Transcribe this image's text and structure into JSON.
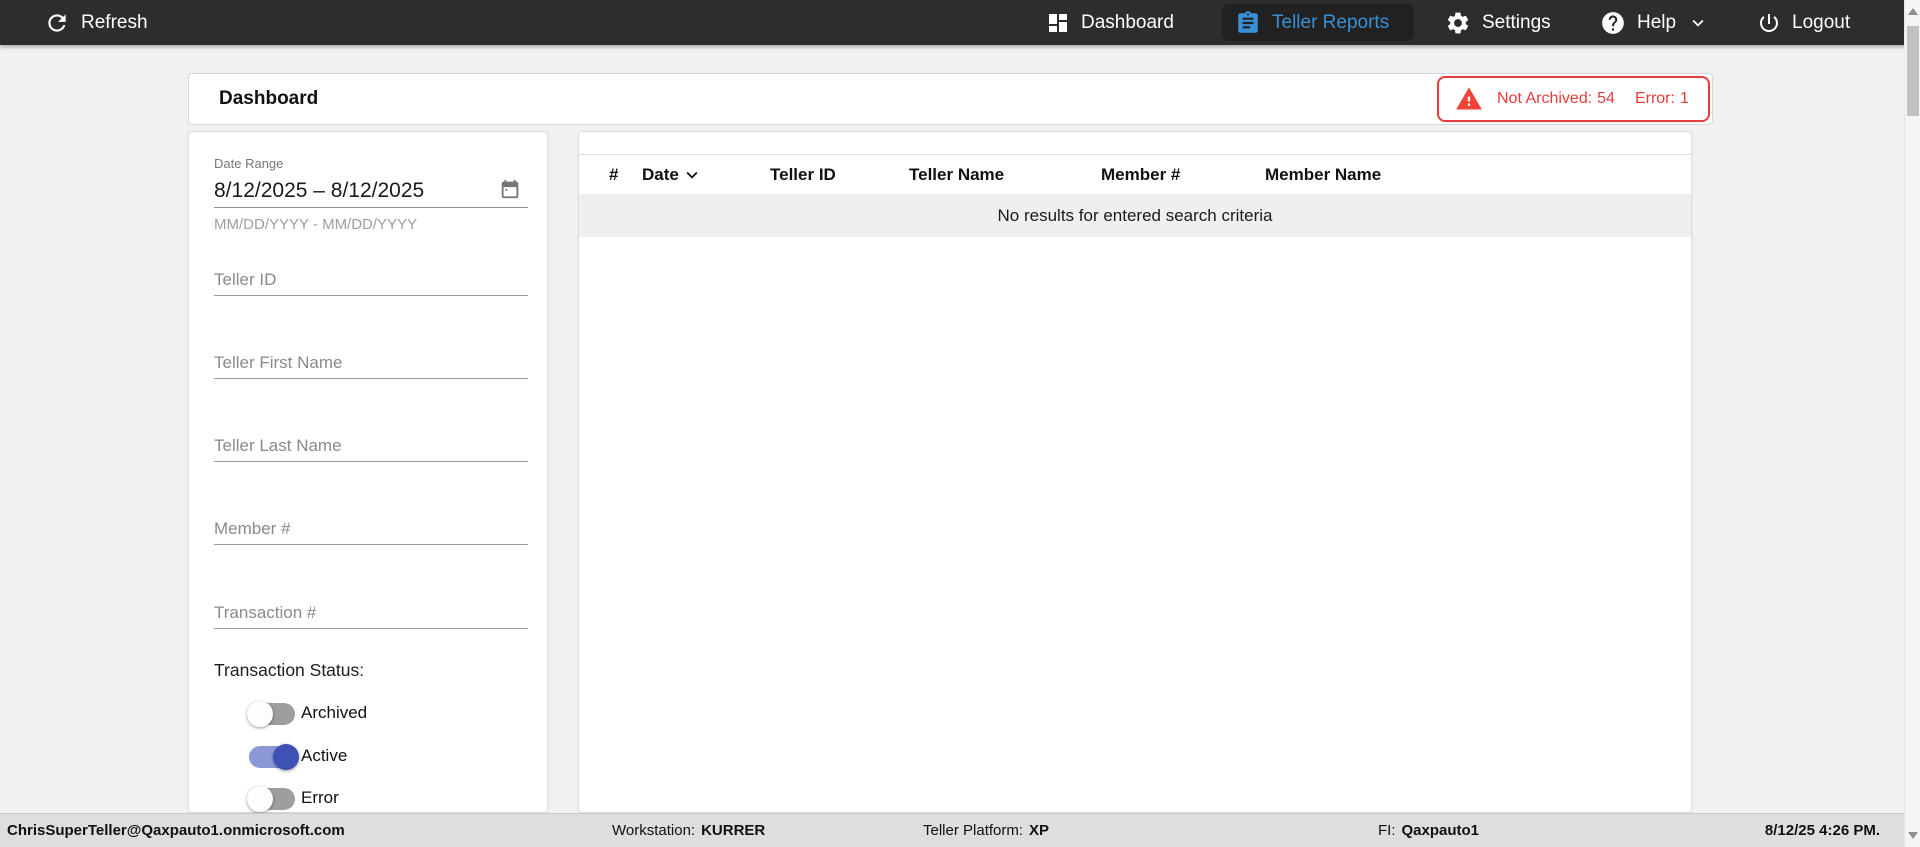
{
  "topnav": {
    "refresh_label": "Refresh",
    "items": [
      {
        "id": "dashboard",
        "label": "Dashboard",
        "active": false
      },
      {
        "id": "teller-reports",
        "label": "Teller Reports",
        "active": true
      },
      {
        "id": "settings",
        "label": "Settings",
        "active": false
      },
      {
        "id": "help",
        "label": "Help",
        "active": false,
        "has_dropdown": true
      },
      {
        "id": "logout",
        "label": "Logout",
        "active": false
      }
    ]
  },
  "header": {
    "title": "Dashboard",
    "alert": {
      "icon": "warning-triangle-icon",
      "not_archived": {
        "label": "Not Archived:",
        "value": 54
      },
      "error": {
        "label": "Error:",
        "value": 1
      }
    }
  },
  "filters": {
    "date_range": {
      "label": "Date Range",
      "value": "8/12/2025 – 8/12/2025",
      "hint": "MM/DD/YYYY - MM/DD/YYYY",
      "icon": "calendar-icon"
    },
    "fields": [
      {
        "id": "teller-id",
        "placeholder": "Teller ID"
      },
      {
        "id": "teller-first-name",
        "placeholder": "Teller First Name"
      },
      {
        "id": "teller-last-name",
        "placeholder": "Teller Last Name"
      },
      {
        "id": "member-number",
        "placeholder": "Member #"
      },
      {
        "id": "transaction-number",
        "placeholder": "Transaction #"
      }
    ],
    "status": {
      "label": "Transaction Status:",
      "toggles": [
        {
          "label": "Archived",
          "on": false
        },
        {
          "label": "Active",
          "on": true
        },
        {
          "label": "Error",
          "on": false
        }
      ]
    }
  },
  "results": {
    "columns": [
      "#",
      "Date",
      "Teller ID",
      "Teller Name",
      "Member #",
      "Member Name"
    ],
    "sorted_column": "Date",
    "sort_direction": "desc",
    "empty_message": "No results for entered search criteria",
    "rows": []
  },
  "statusbar": {
    "user": "ChrisSuperTeller@Qaxpauto1.onmicrosoft.com",
    "workstation_label": "Workstation:",
    "workstation": "KURRER",
    "platform_label": "Teller Platform:",
    "platform": "XP",
    "fi_label": "FI:",
    "fi": "Qaxpauto1",
    "timestamp": "8/12/25 4:26 PM."
  },
  "colors": {
    "nav_bg": "#2d2d2d",
    "accent_blue": "#3a90d5",
    "alert_red": "#e83b3b",
    "toggle_on_thumb": "#3f51b5",
    "toggle_on_track": "#8d99d6",
    "page_bg": "#f1f1f1",
    "empty_row_bg": "#efefef"
  }
}
